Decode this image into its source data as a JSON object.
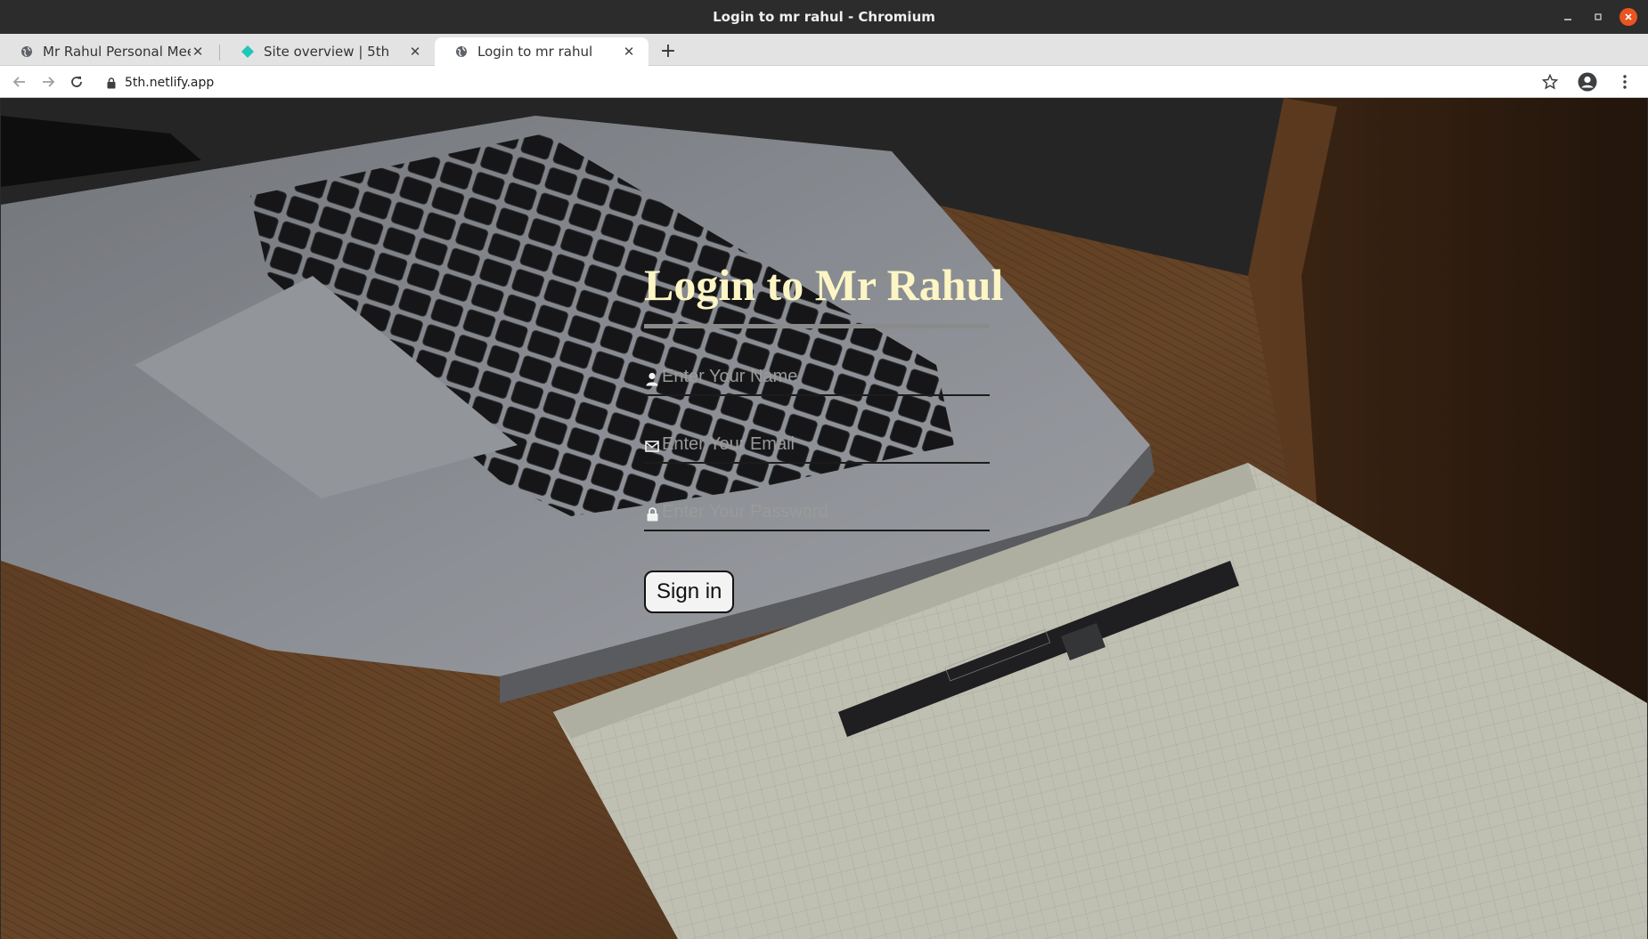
{
  "window": {
    "title": "Login to mr rahul - Chromium"
  },
  "tabs": [
    {
      "label": "Mr Rahul Personal Meet",
      "icon": "globe-icon"
    },
    {
      "label": "Site overview | 5th",
      "icon": "netlify-icon"
    },
    {
      "label": "Login to mr rahul",
      "icon": "globe-icon",
      "active": true
    }
  ],
  "toolbar": {
    "url": "5th.netlify.app"
  },
  "login": {
    "title": "Login to Mr Rahul",
    "name_placeholder": "Enter Your Name",
    "email_placeholder": "Enter Your Email",
    "password_placeholder": "Enter Your Password",
    "signin_label": "Sign in"
  },
  "colors": {
    "title": "#fdf6c4",
    "close_button": "#e95420",
    "netlify": "#20c6b7"
  }
}
